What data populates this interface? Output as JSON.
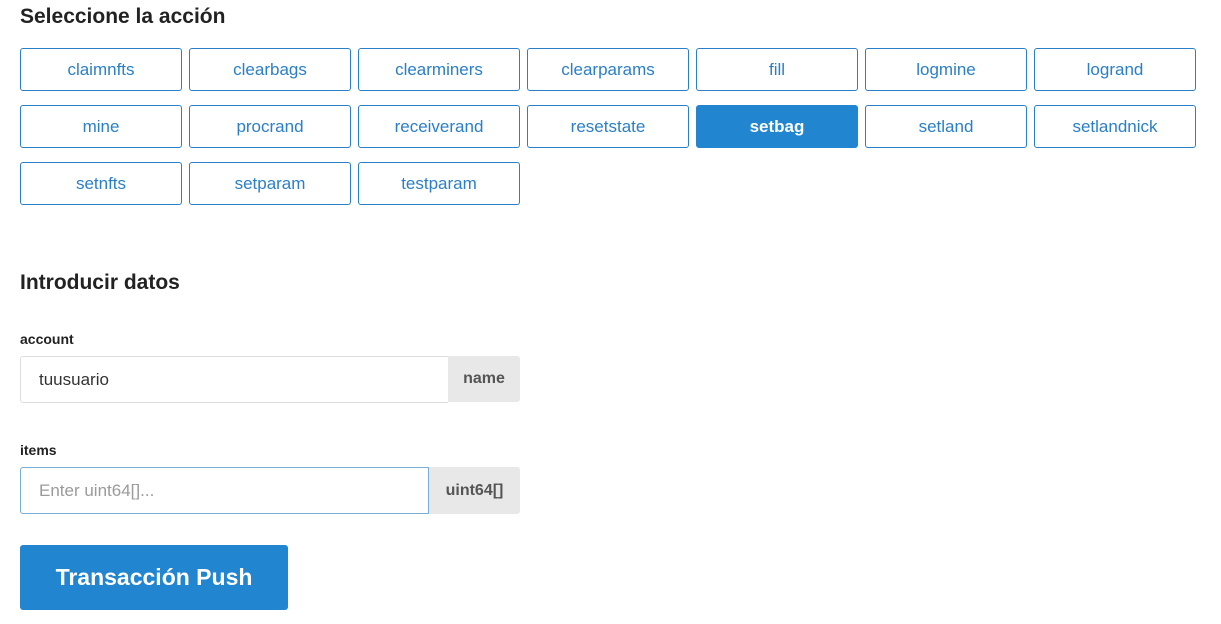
{
  "actions_section": {
    "title": "Seleccione la acción",
    "selected": "setbag",
    "buttons": [
      "claimnfts",
      "clearbags",
      "clearminers",
      "clearparams",
      "fill",
      "logmine",
      "logrand",
      "mine",
      "procrand",
      "receiverand",
      "resetstate",
      "setbag",
      "setland",
      "setlandnick",
      "setnfts",
      "setparam",
      "testparam"
    ]
  },
  "data_section": {
    "title": "Introducir datos",
    "fields": {
      "account": {
        "label": "account",
        "value": "tuusuario",
        "type": "name"
      },
      "items": {
        "label": "items",
        "value": "",
        "placeholder": "Enter uint64[]...",
        "type": "uint64[]"
      }
    }
  },
  "submit": {
    "label": "Transacción Push"
  },
  "colors": {
    "accent": "#2185d0",
    "outline": "#2a7fc6",
    "addon_bg": "#e8e8e8"
  }
}
